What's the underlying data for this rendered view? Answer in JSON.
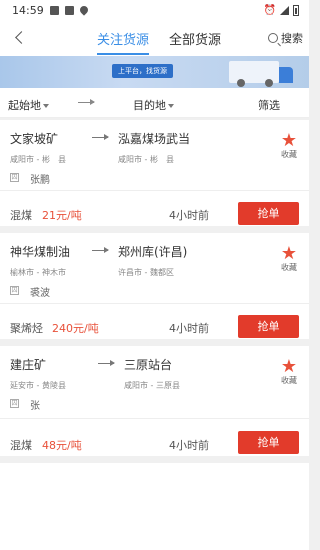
{
  "status": {
    "time": "14:59",
    "battery_icon": "battery-icon"
  },
  "nav": {
    "tab_follow": "关注货源",
    "tab_all": "全部货源",
    "search_label": "搜索"
  },
  "banner": {
    "tag": "上平台，找货源"
  },
  "filter": {
    "origin": "起始地",
    "destination": "目的地",
    "screen": "筛选"
  },
  "listings": [
    {
      "origin": "文家坡矿",
      "origin_region": "咸阳市 - 彬　县",
      "destination": "泓嘉煤场武当",
      "dest_region": "咸阳市 - 彬　县",
      "contact": "张鹏",
      "fav_label": "收藏",
      "cargo": "混煤",
      "price": "21元/吨",
      "time": "4小时前",
      "button": "抢单"
    },
    {
      "origin": "神华煤制油",
      "origin_region": "榆林市 - 神木市",
      "destination": "郑州库(许昌)",
      "dest_region": "许昌市 - 魏都区",
      "contact": "裘波",
      "fav_label": "收藏",
      "cargo": "聚烯烃",
      "price": "240元/吨",
      "time": "4小时前",
      "button": "抢单"
    },
    {
      "origin": "建庄矿",
      "origin_region": "延安市 - 黄陵县",
      "destination": "三原站台",
      "dest_region": "咸阳市 - 三原县",
      "contact": "张",
      "fav_label": "收藏",
      "cargo": "混煤",
      "price": "48元/吨",
      "time": "4小时前",
      "button": "抢单"
    }
  ]
}
